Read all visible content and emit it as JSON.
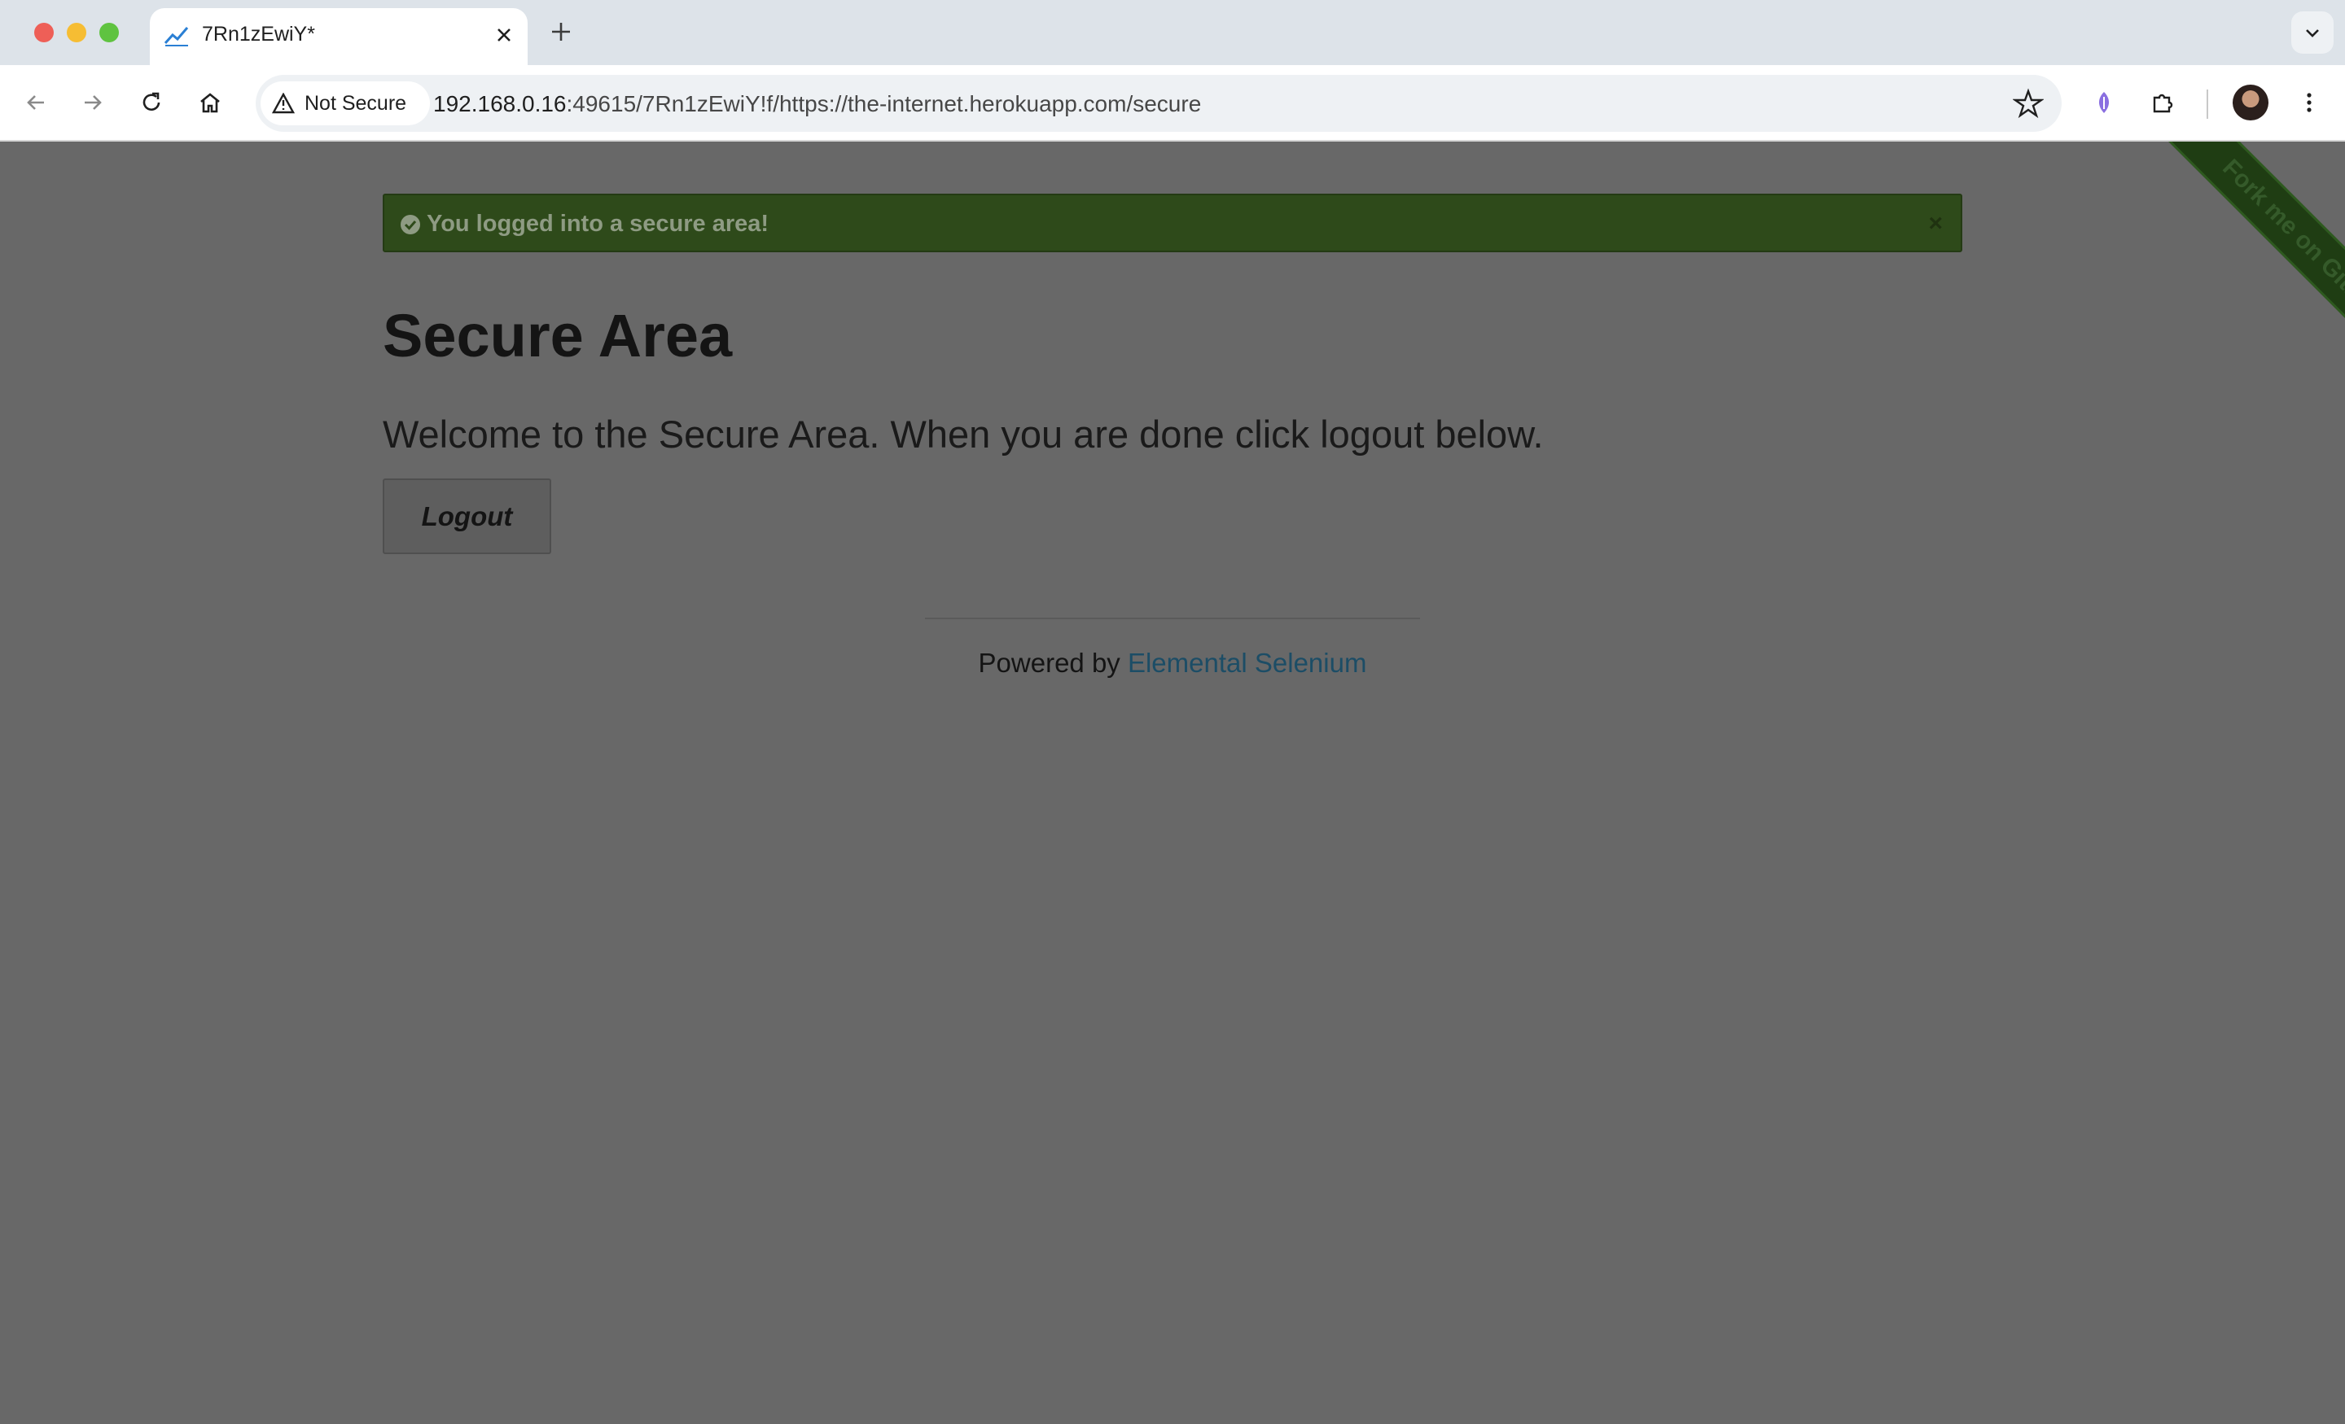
{
  "browser": {
    "tab": {
      "title": "7Rn1zEwiY*"
    },
    "address_bar": {
      "security_label": "Not Secure",
      "url_host": "192.168.0.16",
      "url_rest": ":49615/7Rn1zEwiY!f/https://the-internet.herokuapp.com/secure"
    }
  },
  "page": {
    "flash": {
      "message": "You logged into a secure area!",
      "close_glyph": "×"
    },
    "title": "Secure Area",
    "subheader": "Welcome to the Secure Area. When you are done click logout below.",
    "logout_label": "Logout",
    "footer": {
      "prefix": "Powered by",
      "link_text": "Elemental Selenium"
    },
    "fork_ribbon": "Fork me on GitHub"
  },
  "colors": {
    "page_overlay": "#686868",
    "flash_background": "#2e4a1a",
    "link": "#1c4d66"
  }
}
